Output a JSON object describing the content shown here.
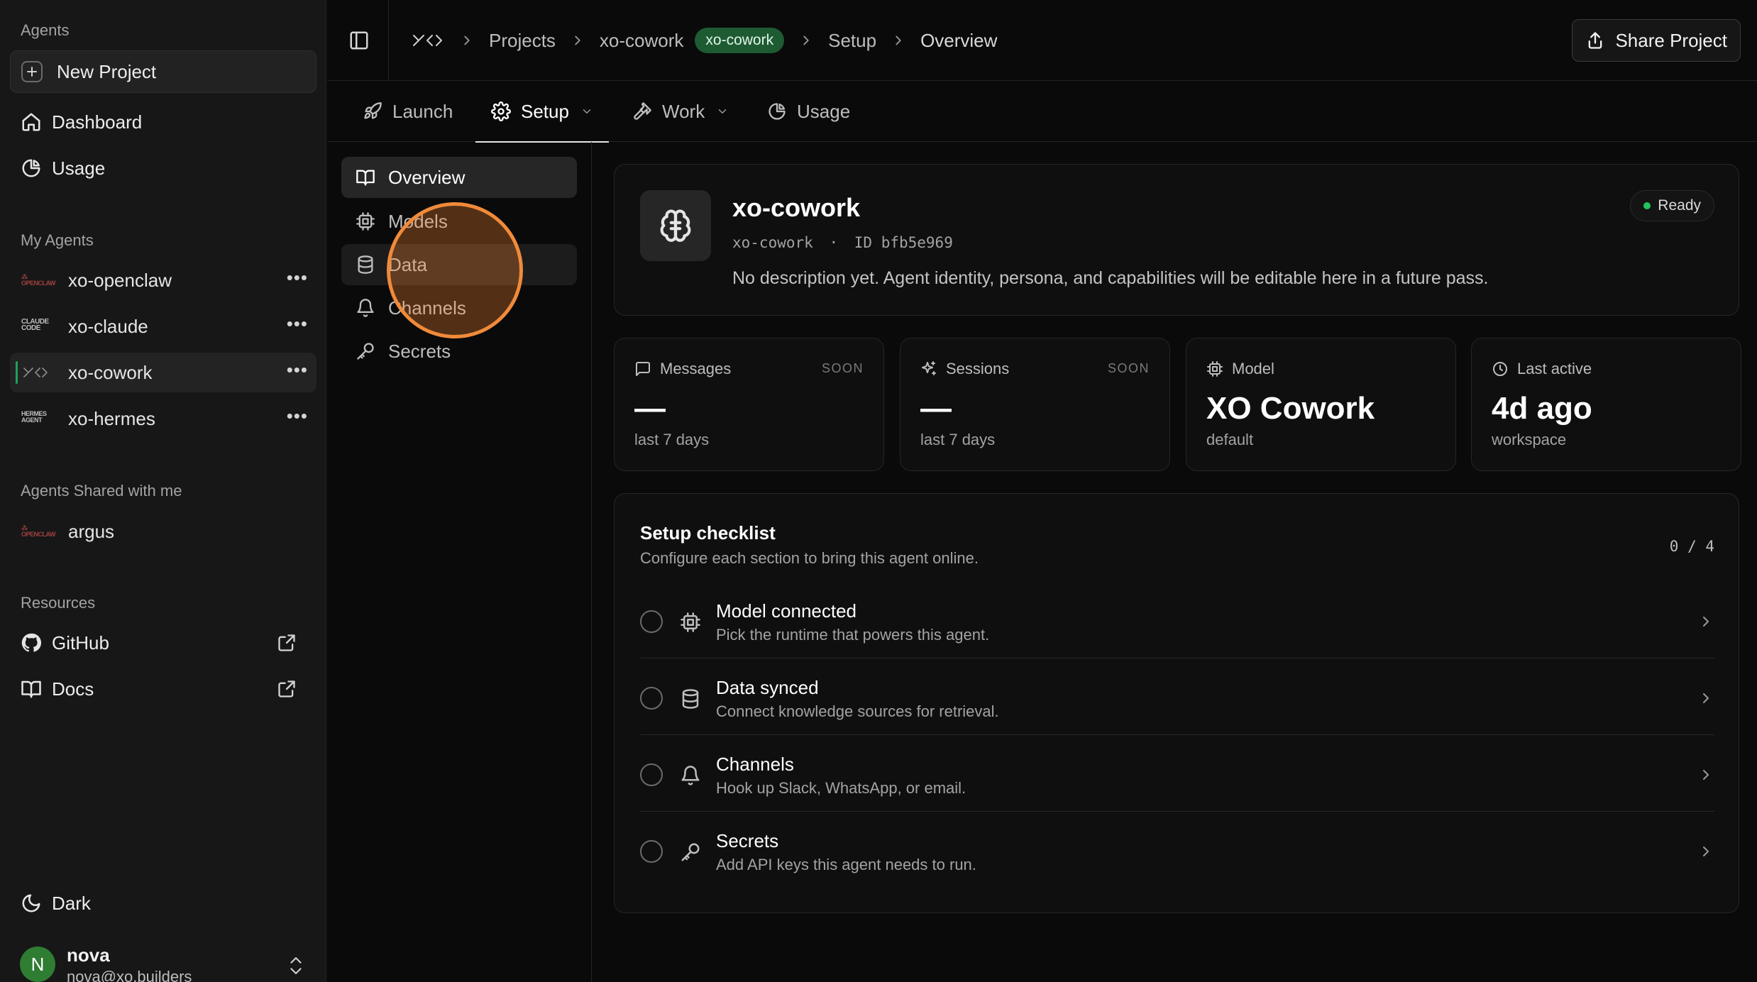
{
  "sidebar": {
    "agents_label": "Agents",
    "new_project": "New Project",
    "nav": [
      {
        "label": "Dashboard",
        "icon": "home-icon"
      },
      {
        "label": "Usage",
        "icon": "pie-chart-icon"
      }
    ],
    "my_agents_label": "My Agents",
    "my_agents": [
      {
        "name": "xo-openclaw",
        "logo": "OPENCLAW"
      },
      {
        "name": "xo-claude",
        "logo": "CLAUDE CODE"
      },
      {
        "name": "xo-cowork",
        "logo": "XO",
        "active": true
      },
      {
        "name": "xo-hermes",
        "logo": "HERMES AGENT"
      }
    ],
    "shared_label": "Agents Shared with me",
    "shared_agents": [
      {
        "name": "argus",
        "logo": "OPENCLAW"
      }
    ],
    "resources_label": "Resources",
    "resources": [
      {
        "label": "GitHub",
        "icon": "github-icon"
      },
      {
        "label": "Docs",
        "icon": "book-icon"
      }
    ],
    "theme_label": "Dark",
    "user": {
      "initial": "N",
      "name": "nova",
      "email": "nova@xo.builders"
    }
  },
  "topbar": {
    "breadcrumbs": [
      "Projects",
      "xo-cowork",
      "Setup",
      "Overview"
    ],
    "project_badge": "xo-cowork",
    "share_label": "Share Project"
  },
  "tabs": [
    {
      "label": "Launch",
      "icon": "rocket-icon"
    },
    {
      "label": "Setup",
      "icon": "gear-icon",
      "active": true
    },
    {
      "label": "Work",
      "icon": "hammer-icon"
    },
    {
      "label": "Usage",
      "icon": "pie-chart-icon"
    }
  ],
  "subnav": [
    {
      "label": "Overview",
      "icon": "book-open-icon",
      "active": true
    },
    {
      "label": "Models",
      "icon": "cpu-icon"
    },
    {
      "label": "Data",
      "icon": "database-icon"
    },
    {
      "label": "Channels",
      "icon": "bell-icon"
    },
    {
      "label": "Secrets",
      "icon": "key-icon"
    }
  ],
  "agent": {
    "name": "xo-cowork",
    "slug": "xo-cowork",
    "id_label": "ID bfb5e969",
    "separator": "·",
    "description": "No description yet. Agent identity, persona, and capabilities will be editable here in a future pass.",
    "status": "Ready"
  },
  "stats": [
    {
      "label": "Messages",
      "badge": "SOON",
      "value": "—",
      "sub": "last 7 days",
      "icon": "message-icon"
    },
    {
      "label": "Sessions",
      "badge": "SOON",
      "value": "—",
      "sub": "last 7 days",
      "icon": "sparkles-icon"
    },
    {
      "label": "Model",
      "badge": "",
      "value": "XO Cowork",
      "sub": "default",
      "icon": "cpu-icon"
    },
    {
      "label": "Last active",
      "badge": "",
      "value": "4d ago",
      "sub": "workspace",
      "icon": "clock-icon"
    }
  ],
  "checklist": {
    "title": "Setup checklist",
    "subtitle": "Configure each section to bring this agent online.",
    "count": "0 / 4",
    "items": [
      {
        "name": "Model connected",
        "desc": "Pick the runtime that powers this agent.",
        "icon": "cpu-icon"
      },
      {
        "name": "Data synced",
        "desc": "Connect knowledge sources for retrieval.",
        "icon": "database-icon"
      },
      {
        "name": "Channels",
        "desc": "Hook up Slack, WhatsApp, or email.",
        "icon": "bell-icon"
      },
      {
        "name": "Secrets",
        "desc": "Add API keys this agent needs to run.",
        "icon": "key-icon"
      }
    ]
  },
  "colors": {
    "accent_green": "#22c55e",
    "badge_green": "#1e5b33",
    "cursor_orange": "#f08a3a"
  }
}
